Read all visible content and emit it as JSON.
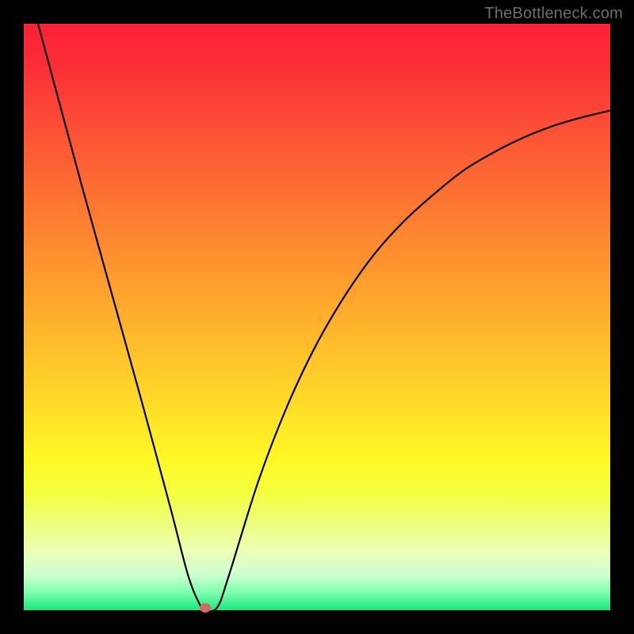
{
  "watermark": "TheBottleneck.com",
  "colors": {
    "frame_bg": "#000000",
    "gradient_top": "#fb2137",
    "gradient_bottom": "#17e97e",
    "curve_stroke": "#000000",
    "marker_fill": "#d1695f"
  },
  "chart_data": {
    "type": "line",
    "title": "",
    "xlabel": "",
    "ylabel": "",
    "xlim": [
      0,
      100
    ],
    "ylim": [
      0,
      100
    ],
    "grid": false,
    "legend_position": "none",
    "series": [
      {
        "name": "bottleneck-curve",
        "x": [
          0,
          5,
          10,
          15,
          20,
          25,
          28,
          30,
          31,
          33,
          35,
          40,
          45,
          50,
          55,
          60,
          65,
          70,
          75,
          80,
          85,
          90,
          95,
          100
        ],
        "values": [
          109,
          90.5,
          72,
          54,
          36,
          17.5,
          6,
          1,
          0,
          0.5,
          6,
          22,
          35,
          45.5,
          54,
          61,
          66.5,
          71,
          75,
          78,
          80.5,
          82.5,
          84,
          85.2
        ]
      }
    ],
    "annotations": [
      {
        "name": "optimal-point",
        "x": 31,
        "y": 0
      }
    ]
  }
}
